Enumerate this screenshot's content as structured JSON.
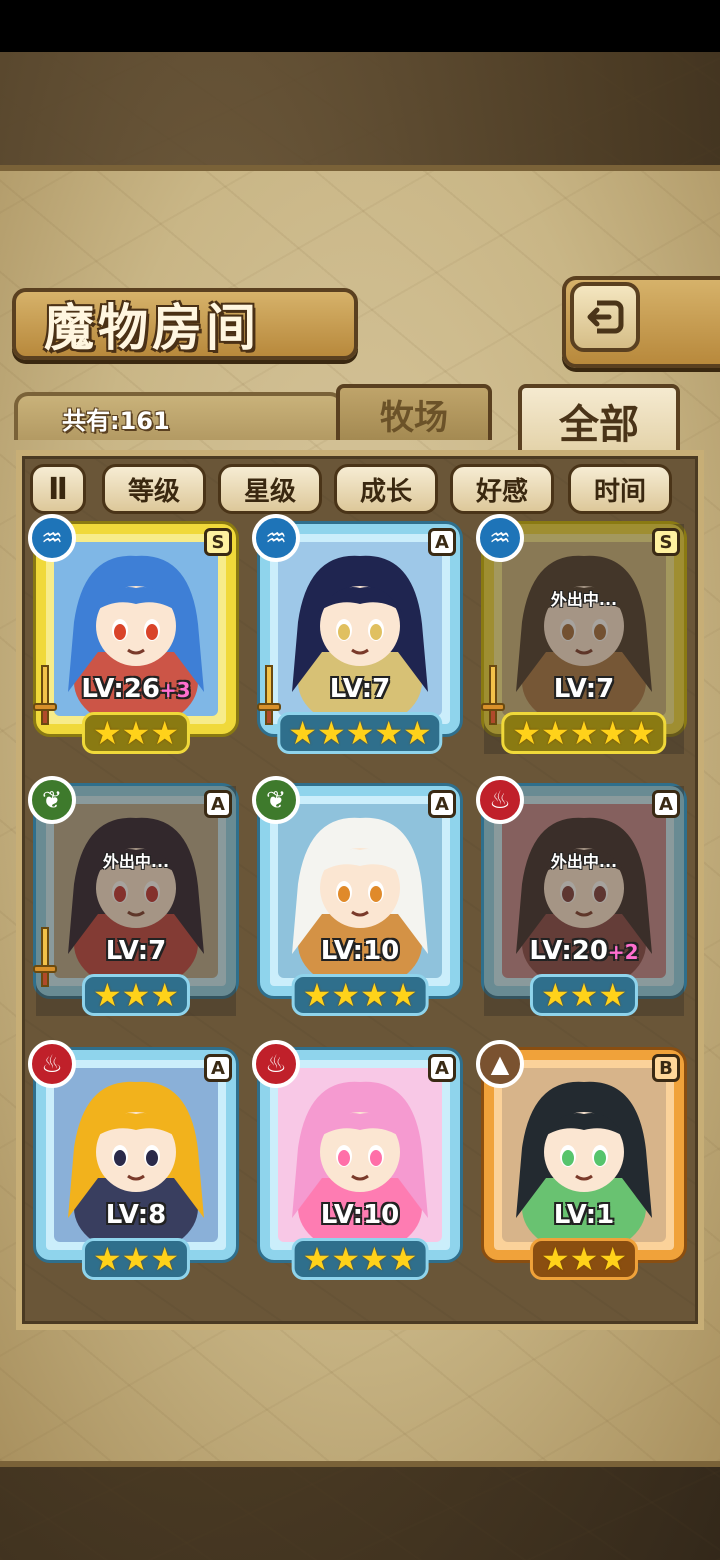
{
  "header": {
    "title": "魔物房间",
    "back_icon": "return-arrow-icon"
  },
  "summary": {
    "count_label": "共有:161"
  },
  "tabs": [
    {
      "label": "牧场",
      "selected": false
    },
    {
      "label": "全部",
      "selected": true
    }
  ],
  "sort": {
    "toggle_label": "Ⅱ",
    "buttons": [
      "等级",
      "星级",
      "成长",
      "好感",
      "时间"
    ]
  },
  "monsters": [
    {
      "element": "water",
      "element_icon": "water-element-icon",
      "rank": "S",
      "level": "LV:26",
      "bonus": "+3",
      "stars": "★★★",
      "frame": "yellow",
      "equipped": true,
      "away": ""
    },
    {
      "element": "water",
      "element_icon": "water-element-icon",
      "rank": "A",
      "level": "LV:7",
      "bonus": "",
      "stars": "★★★★★",
      "frame": "blue",
      "equipped": true,
      "away": ""
    },
    {
      "element": "water",
      "element_icon": "water-element-icon",
      "rank": "S",
      "level": "LV:7",
      "bonus": "",
      "stars": "★★★★★",
      "frame": "yellow",
      "equipped": true,
      "away": "外出中..."
    },
    {
      "element": "wind",
      "element_icon": "wind-element-icon",
      "rank": "A",
      "level": "LV:7",
      "bonus": "",
      "stars": "★★★",
      "frame": "blue",
      "equipped": true,
      "away": "外出中..."
    },
    {
      "element": "wind",
      "element_icon": "wind-element-icon",
      "rank": "A",
      "level": "LV:10",
      "bonus": "",
      "stars": "★★★★",
      "frame": "blue",
      "equipped": false,
      "away": ""
    },
    {
      "element": "fire",
      "element_icon": "fire-element-icon",
      "rank": "A",
      "level": "LV:20",
      "bonus": "+2",
      "stars": "★★★",
      "frame": "blue",
      "equipped": false,
      "away": "外出中..."
    },
    {
      "element": "fire",
      "element_icon": "fire-element-icon",
      "rank": "A",
      "level": "LV:8",
      "bonus": "",
      "stars": "★★★",
      "frame": "blue",
      "equipped": false,
      "away": ""
    },
    {
      "element": "fire",
      "element_icon": "fire-element-icon",
      "rank": "A",
      "level": "LV:10",
      "bonus": "",
      "stars": "★★★★",
      "frame": "blue",
      "equipped": false,
      "away": ""
    },
    {
      "element": "earth",
      "element_icon": "earth-element-icon",
      "rank": "B",
      "level": "LV:1",
      "bonus": "",
      "stars": "★★★",
      "frame": "orange",
      "equipped": false,
      "away": ""
    }
  ],
  "portrait_palettes": [
    {
      "hair": "#3e7fd6",
      "bg": "#7fb7e6",
      "accent": "#d9442a"
    },
    {
      "hair": "#1f2550",
      "bg": "#9ec8e8",
      "accent": "#e0c060"
    },
    {
      "hair": "#4a3a2a",
      "bg": "#c9b27a",
      "accent": "#a06a3a"
    },
    {
      "hair": "#2a2030",
      "bg": "#b6a88a",
      "accent": "#c03030"
    },
    {
      "hair": "#f4f4f0",
      "bg": "#8fc2dc",
      "accent": "#e08a2a"
    },
    {
      "hair": "#3a2a2a",
      "bg": "#c2868a",
      "accent": "#7a3a3a"
    },
    {
      "hair": "#f2b21c",
      "bg": "#8ab0d8",
      "accent": "#2a2a4a"
    },
    {
      "hair": "#f59ad0",
      "bg": "#f8c8e6",
      "accent": "#ff6fa8"
    },
    {
      "hair": "#232a30",
      "bg": "#d7b48a",
      "accent": "#56c46c"
    }
  ]
}
